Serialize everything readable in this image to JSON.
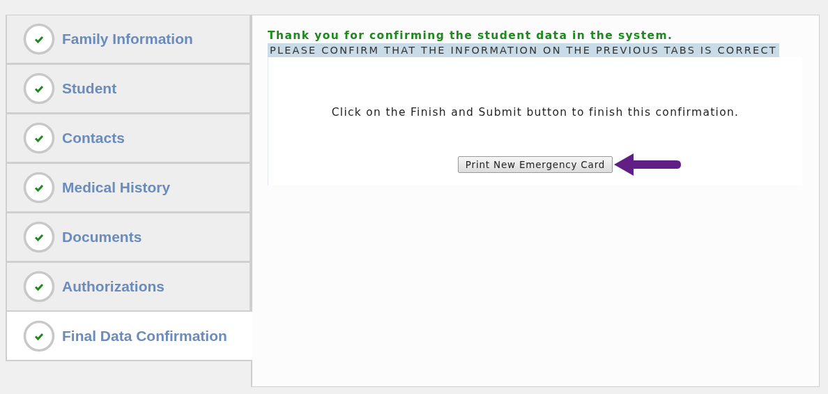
{
  "tabs": [
    {
      "label": "Family Information",
      "complete": true,
      "selected": false
    },
    {
      "label": "Student",
      "complete": true,
      "selected": false
    },
    {
      "label": "Contacts",
      "complete": true,
      "selected": false
    },
    {
      "label": "Medical History",
      "complete": true,
      "selected": false
    },
    {
      "label": "Documents",
      "complete": true,
      "selected": false
    },
    {
      "label": "Authorizations",
      "complete": true,
      "selected": false
    },
    {
      "label": "Final Data Confirmation",
      "complete": true,
      "selected": true
    }
  ],
  "content": {
    "title": "Thank you for confirming the student data in the system.",
    "banner": "PLEASE CONFIRM THAT THE INFORMATION ON THE PREVIOUS TABS IS CORRECT",
    "instruction": "Click on the Finish and Submit button to finish this confirmation.",
    "button": "Print New Emergency Card"
  }
}
